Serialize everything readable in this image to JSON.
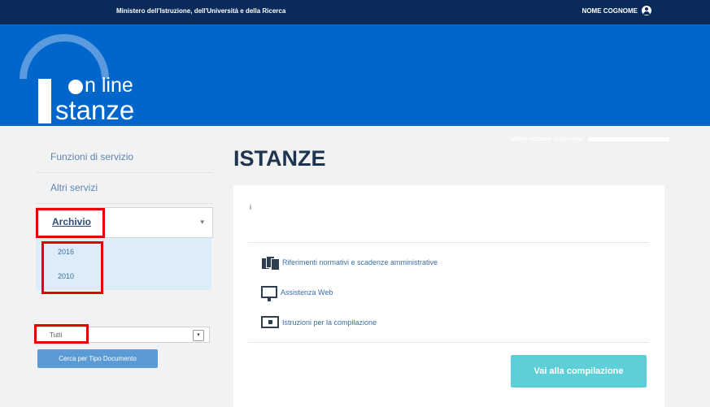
{
  "header": {
    "ministry": "Ministero dell'Istruzione, dell'Università e della Ricerca",
    "user_name": "NOME COGNOME",
    "user_icon": "user-circle-icon",
    "last_access_label": "ultimo accesso al Servizio:"
  },
  "logo": {
    "line1": "n line",
    "line2": "stanze"
  },
  "sidebar": {
    "items": [
      {
        "label": "Funzioni di servizio"
      },
      {
        "label": "Altri servizi"
      }
    ],
    "archivio": {
      "label": "Archivio",
      "chevron": "▾"
    },
    "years": [
      "2016",
      "2010"
    ],
    "select": {
      "value": "Tutti",
      "arrow": "▾"
    },
    "search_button": "Cerca per Tipo Documento"
  },
  "main": {
    "title": "ISTANZE",
    "hint": "i",
    "links": [
      {
        "label": "Riferimenti normativi e scadenze amministrative",
        "icon": "documents-icon"
      },
      {
        "label": "Assistenza Web",
        "icon": "monitor-icon"
      },
      {
        "label": "Istruzioni per la compilazione",
        "icon": "screen-icon"
      }
    ],
    "action_button": "Vai alla compilazione"
  },
  "colors": {
    "topbar": "#0a2a5a",
    "banner": "#0066cc",
    "highlight": "#e60000",
    "action": "#5ecfd8"
  }
}
